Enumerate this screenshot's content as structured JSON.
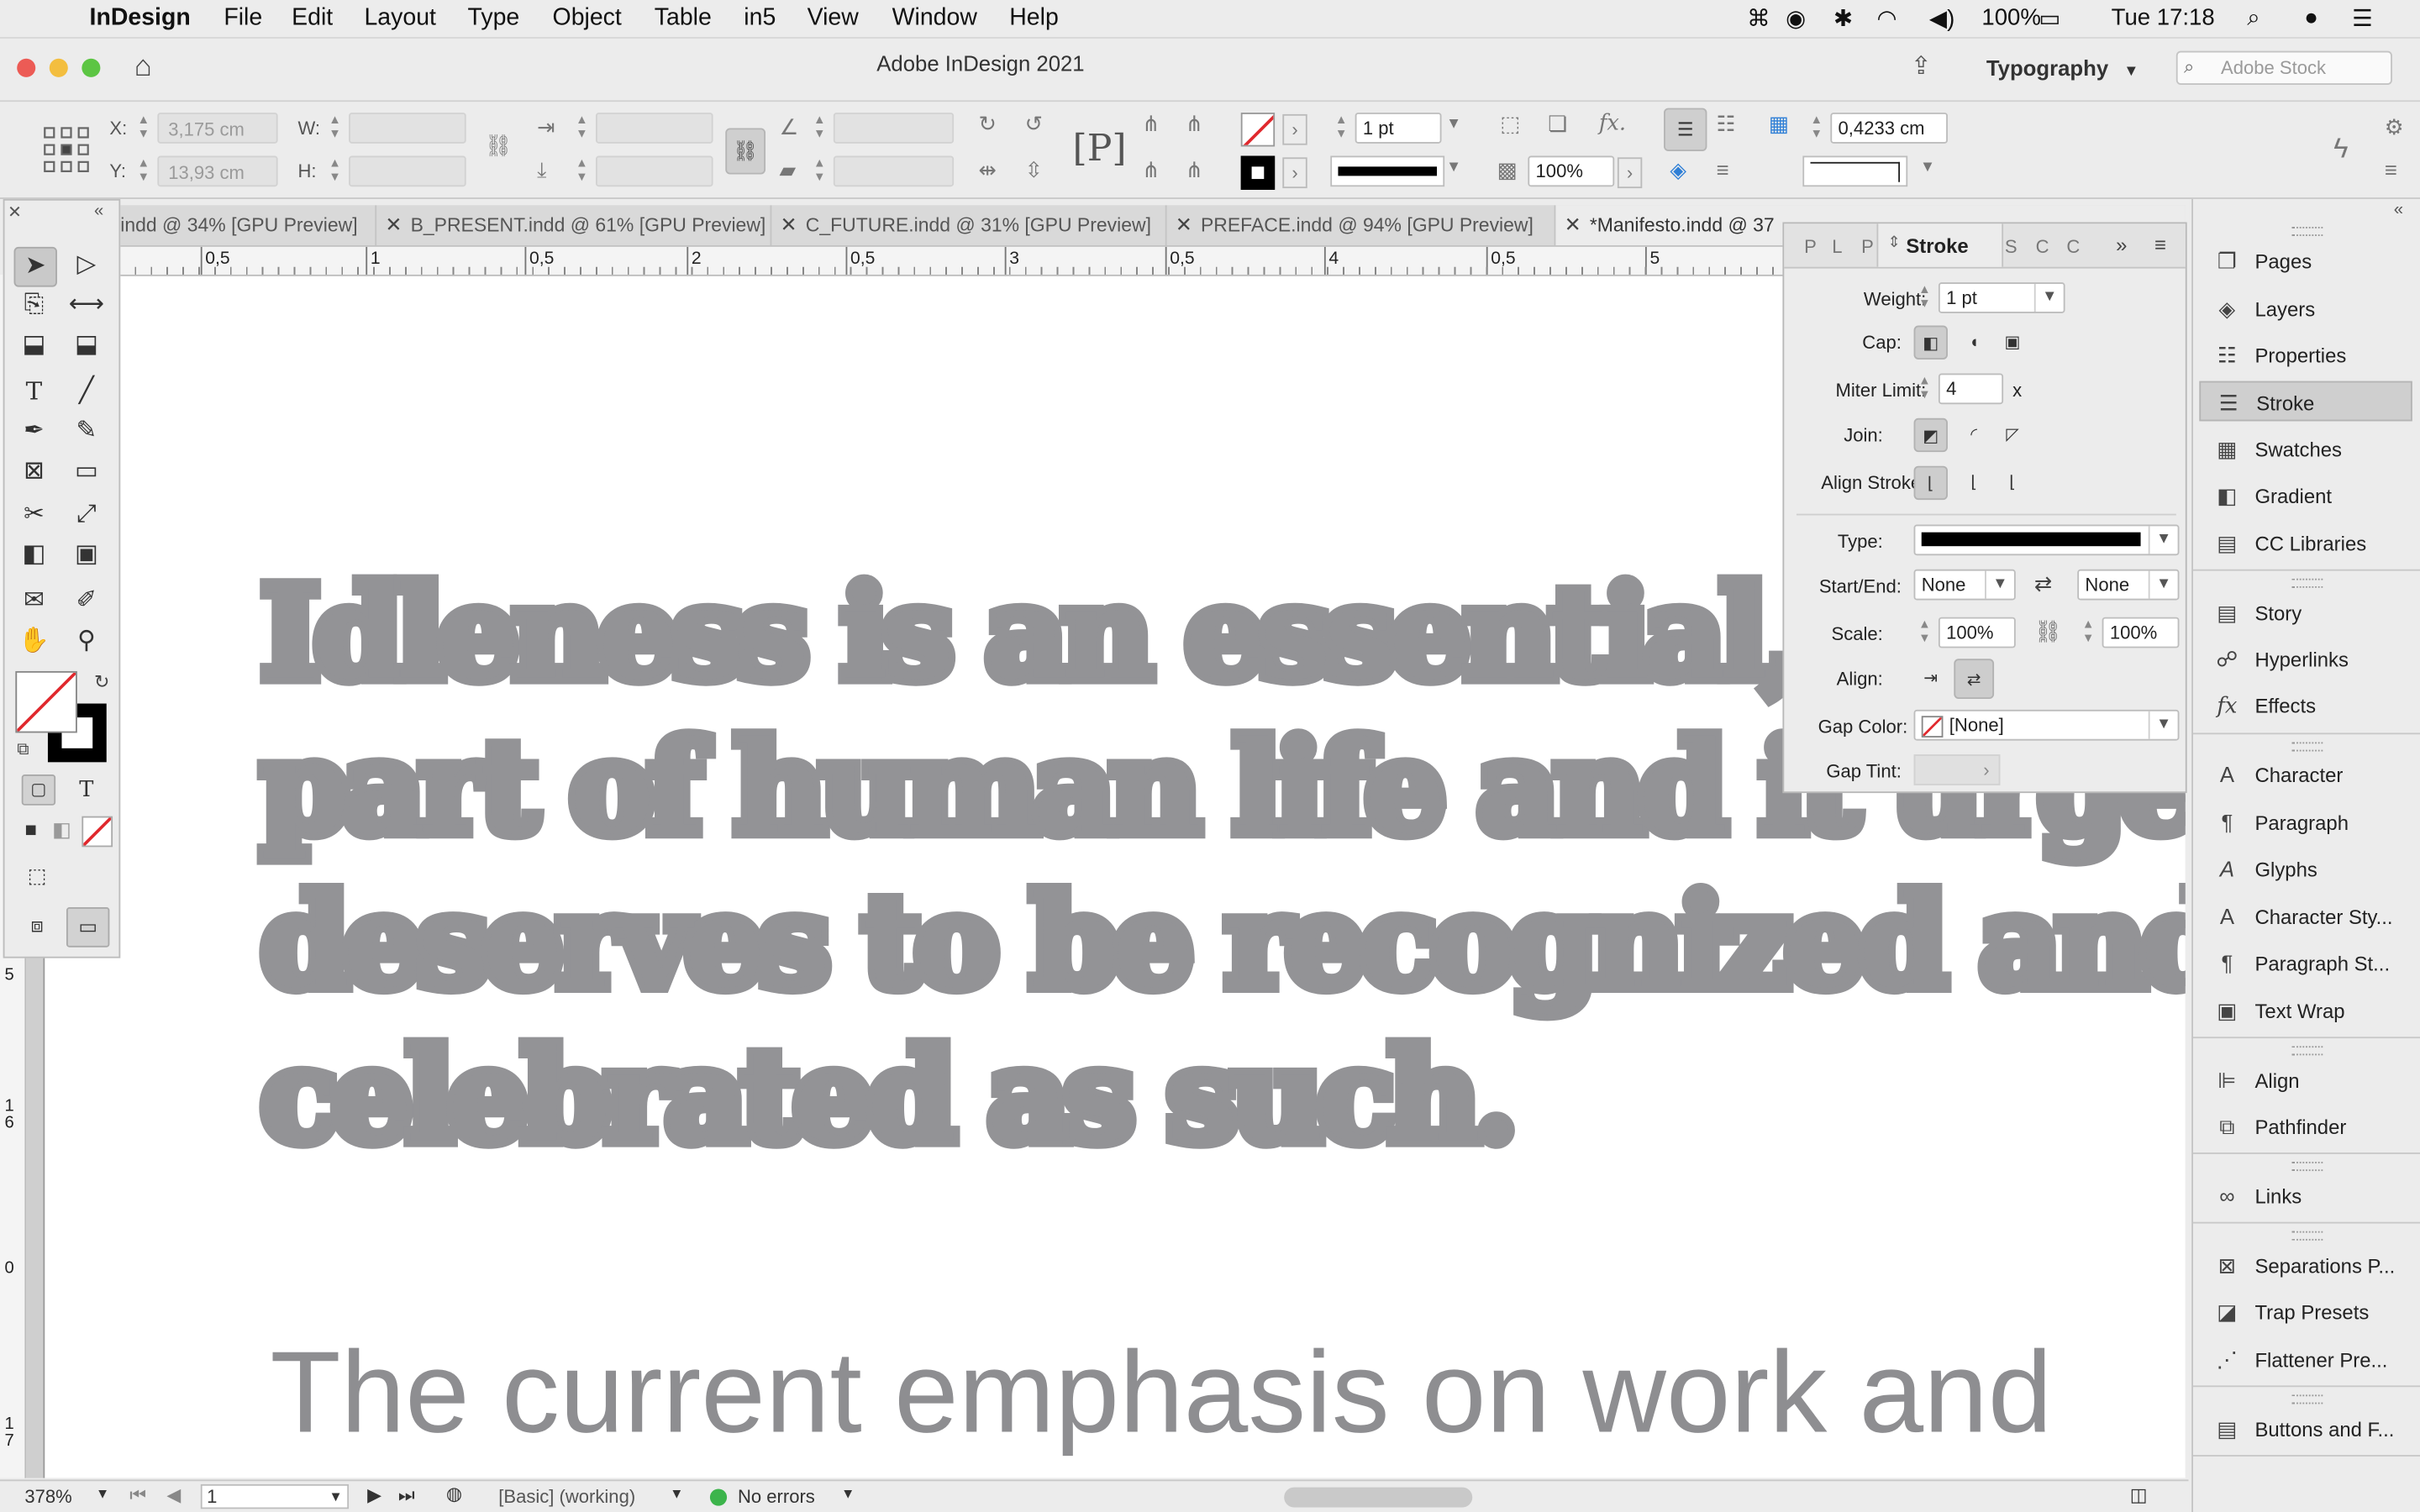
{
  "menubar": {
    "app": "InDesign",
    "items": [
      "File",
      "Edit",
      "Layout",
      "Type",
      "Object",
      "Table",
      "in5",
      "View",
      "Window",
      "Help"
    ],
    "battery": "100%",
    "clock": "Tue 17:18"
  },
  "titlebar": {
    "title": "Adobe InDesign 2021",
    "workspace": "Typography",
    "stock_placeholder": "Adobe Stock"
  },
  "control": {
    "x_label": "X:",
    "x_value": "3,175 cm",
    "y_label": "Y:",
    "y_value": "13,93 cm",
    "w_label": "W:",
    "h_label": "H:",
    "stroke_weight": "1 pt",
    "opacity": "100%",
    "offset": "0,4233 cm"
  },
  "tabs": [
    {
      "label": "indd @ 34% [GPU Preview]"
    },
    {
      "label": "B_PRESENT.indd @ 61% [GPU Preview]"
    },
    {
      "label": "C_FUTURE.indd @ 31% [GPU Preview]"
    },
    {
      "label": "PREFACE.indd @ 94% [GPU Preview]"
    },
    {
      "label": "*Manifesto.indd @ 37"
    }
  ],
  "ruler": {
    "labels": [
      "0,5",
      "1",
      "0,5",
      "2",
      "0,5",
      "3",
      "0,5",
      "4",
      "0,5",
      "5"
    ],
    "vlabels": [
      "5",
      "1 6",
      "0",
      "1 7"
    ]
  },
  "document": {
    "lines": [
      "Idleness is an essential, va",
      "part of human life and it urgentl",
      "deserves to be recognized and",
      "celebrated as such."
    ],
    "body": "The current emphasis on work and"
  },
  "stroke_panel": {
    "collapsed_tabs": [
      "P",
      "L",
      "P"
    ],
    "title": "Stroke",
    "right_tabs": [
      "S",
      "C",
      "C"
    ],
    "weight_label": "Weight:",
    "weight_value": "1 pt",
    "cap_label": "Cap:",
    "miter_label": "Miter Limit:",
    "miter_value": "4",
    "miter_unit": "x",
    "join_label": "Join:",
    "align_stroke_label": "Align Stroke:",
    "type_label": "Type:",
    "startend_label": "Start/End:",
    "start_value": "None",
    "end_value": "None",
    "scale_label": "Scale:",
    "scale_start": "100%",
    "scale_end": "100%",
    "align_label": "Align:",
    "gapcolor_label": "Gap Color:",
    "gapcolor_value": "[None]",
    "gaptint_label": "Gap Tint:"
  },
  "dock": {
    "items": [
      {
        "label": "Pages",
        "icon": "pages-icon"
      },
      {
        "label": "Layers",
        "icon": "layers-icon"
      },
      {
        "label": "Properties",
        "icon": "properties-icon"
      },
      {
        "label": "Stroke",
        "icon": "stroke-icon"
      },
      {
        "label": "Swatches",
        "icon": "swatches-icon"
      },
      {
        "label": "Gradient",
        "icon": "gradient-icon"
      },
      {
        "label": "CC Libraries",
        "icon": "cc-libraries-icon"
      },
      {
        "label": "Story",
        "icon": "story-icon"
      },
      {
        "label": "Hyperlinks",
        "icon": "hyperlinks-icon"
      },
      {
        "label": "Effects",
        "icon": "effects-icon"
      },
      {
        "label": "Character",
        "icon": "character-icon"
      },
      {
        "label": "Paragraph",
        "icon": "paragraph-icon"
      },
      {
        "label": "Glyphs",
        "icon": "glyphs-icon"
      },
      {
        "label": "Character Sty...",
        "icon": "character-styles-icon"
      },
      {
        "label": "Paragraph St...",
        "icon": "paragraph-styles-icon"
      },
      {
        "label": "Text Wrap",
        "icon": "text-wrap-icon"
      },
      {
        "label": "Align",
        "icon": "align-icon"
      },
      {
        "label": "Pathfinder",
        "icon": "pathfinder-icon"
      },
      {
        "label": "Links",
        "icon": "links-icon"
      },
      {
        "label": "Separations P...",
        "icon": "separations-icon"
      },
      {
        "label": "Trap Presets",
        "icon": "trap-presets-icon"
      },
      {
        "label": "Flattener Pre...",
        "icon": "flattener-icon"
      },
      {
        "label": "Buttons and F...",
        "icon": "buttons-forms-icon"
      }
    ]
  },
  "status": {
    "zoom": "378%",
    "page": "1",
    "style": "[Basic] (working)",
    "preflight": "No errors"
  },
  "colors": {
    "text_gray": "#939396",
    "no_errors": "#3cb44b",
    "none_red": "#e0282d"
  }
}
